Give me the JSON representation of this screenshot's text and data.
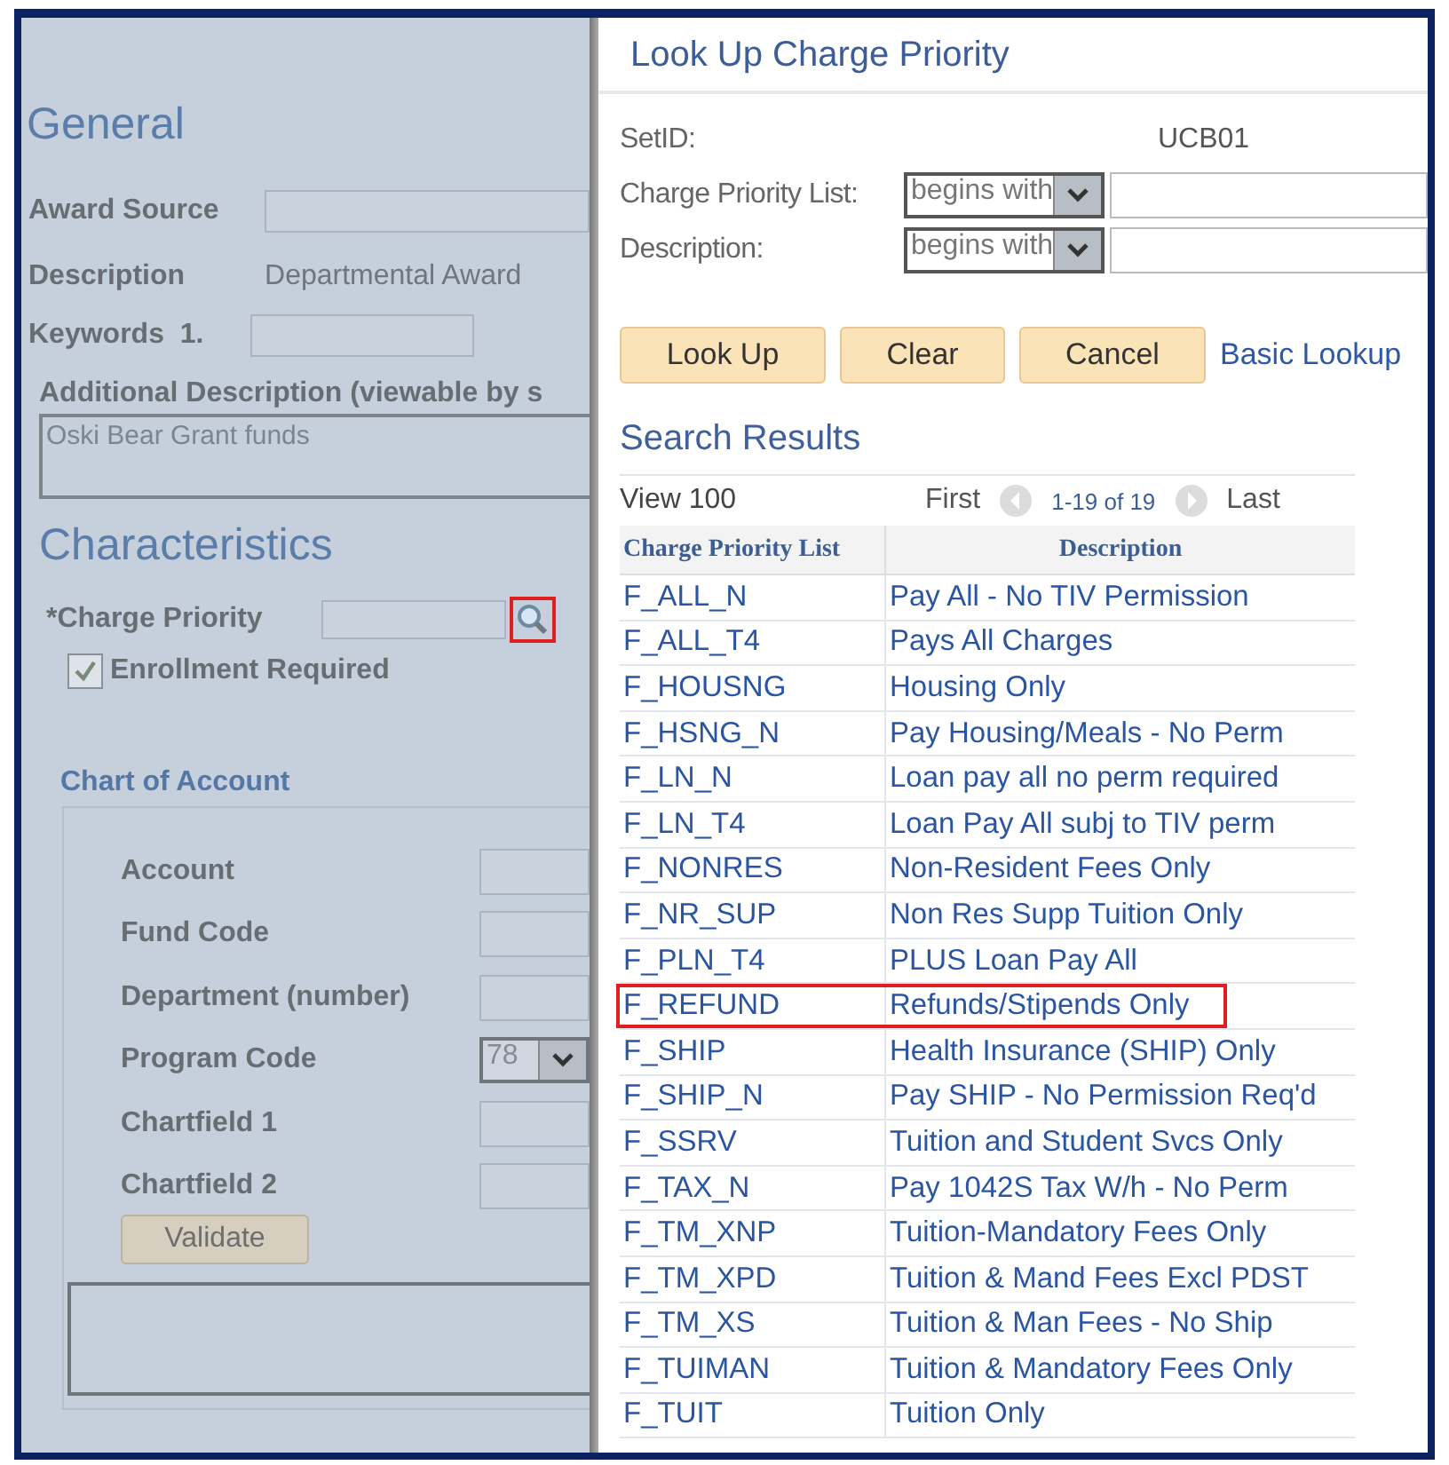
{
  "form": {
    "general_title": "General",
    "award_source_label": "Award Source",
    "description_label": "Description",
    "description_value": "Departmental Award",
    "keywords_label": "Keywords  1.",
    "additional_description_label": "Additional Description (viewable by s",
    "additional_description_value": "Oski Bear Grant funds",
    "characteristics_title": "Characteristics",
    "charge_priority_label": "*Charge Priority",
    "charge_priority_lookup_highlighted": true,
    "enrollment_required": {
      "label": "Enrollment Required",
      "checked": true
    },
    "chart_of_account": {
      "title": "Chart of Account",
      "fields": [
        {
          "label": "Account",
          "kind": "text"
        },
        {
          "label": "Fund Code",
          "kind": "text"
        },
        {
          "label": "Department (number)",
          "kind": "text"
        },
        {
          "label": "Program Code",
          "kind": "select",
          "value": "78"
        },
        {
          "label": "Chartfield 1",
          "kind": "text"
        },
        {
          "label": "Chartfield 2",
          "kind": "text"
        }
      ],
      "validate_button": "Validate"
    }
  },
  "lookup": {
    "title": "Look Up Charge Priority",
    "setid_label": "SetID:",
    "setid_value": "UCB01",
    "criteria": [
      {
        "label": "Charge Priority List:",
        "operator": "begins with"
      },
      {
        "label": "Description:",
        "operator": "begins with"
      }
    ],
    "buttons": [
      "Look Up",
      "Clear",
      "Cancel"
    ],
    "basic_lookup_link": "Basic Lookup",
    "results_title": "Search Results",
    "view_all": "View 100",
    "first": "First",
    "range": "1-19 of 19",
    "last": "Last",
    "columns": [
      "Charge Priority List",
      "Description"
    ],
    "rows": [
      {
        "cells": [
          "F_ALL_N",
          "Pay All - No TIV Permission"
        ],
        "highlighted": false
      },
      {
        "cells": [
          "F_ALL_T4",
          "Pays All Charges"
        ],
        "highlighted": false
      },
      {
        "cells": [
          "F_HOUSNG",
          "Housing Only"
        ],
        "highlighted": false
      },
      {
        "cells": [
          "F_HSNG_N",
          "Pay Housing/Meals - No Perm"
        ],
        "highlighted": false
      },
      {
        "cells": [
          "F_LN_N",
          "Loan pay all no perm required"
        ],
        "highlighted": false
      },
      {
        "cells": [
          "F_LN_T4",
          "Loan Pay All subj to TIV perm"
        ],
        "highlighted": false
      },
      {
        "cells": [
          "F_NONRES",
          "Non-Resident Fees Only"
        ],
        "highlighted": false
      },
      {
        "cells": [
          "F_NR_SUP",
          "Non Res Supp Tuition Only"
        ],
        "highlighted": false
      },
      {
        "cells": [
          "F_PLN_T4",
          "PLUS Loan Pay All"
        ],
        "highlighted": false
      },
      {
        "cells": [
          "F_REFUND",
          "Refunds/Stipends Only"
        ],
        "highlighted": true
      },
      {
        "cells": [
          "F_SHIP",
          "Health Insurance (SHIP) Only"
        ],
        "highlighted": false
      },
      {
        "cells": [
          "F_SHIP_N",
          "Pay SHIP - No Permission Req'd"
        ],
        "highlighted": false
      },
      {
        "cells": [
          "F_SSRV",
          "Tuition and Student Svcs Only"
        ],
        "highlighted": false
      },
      {
        "cells": [
          "F_TAX_N",
          "Pay 1042S Tax W/h - No Perm"
        ],
        "highlighted": false
      },
      {
        "cells": [
          "F_TM_XNP",
          "Tuition-Mandatory Fees Only"
        ],
        "highlighted": false
      },
      {
        "cells": [
          "F_TM_XPD",
          "Tuition & Mand Fees Excl PDST"
        ],
        "highlighted": false
      },
      {
        "cells": [
          "F_TM_XS",
          "Tuition & Man Fees - No Ship"
        ],
        "highlighted": false
      },
      {
        "cells": [
          "F_TUIMAN",
          "Tuition & Mandatory Fees Only"
        ],
        "highlighted": false
      },
      {
        "cells": [
          "F_TUIT",
          "Tuition Only"
        ],
        "highlighted": false
      }
    ]
  }
}
